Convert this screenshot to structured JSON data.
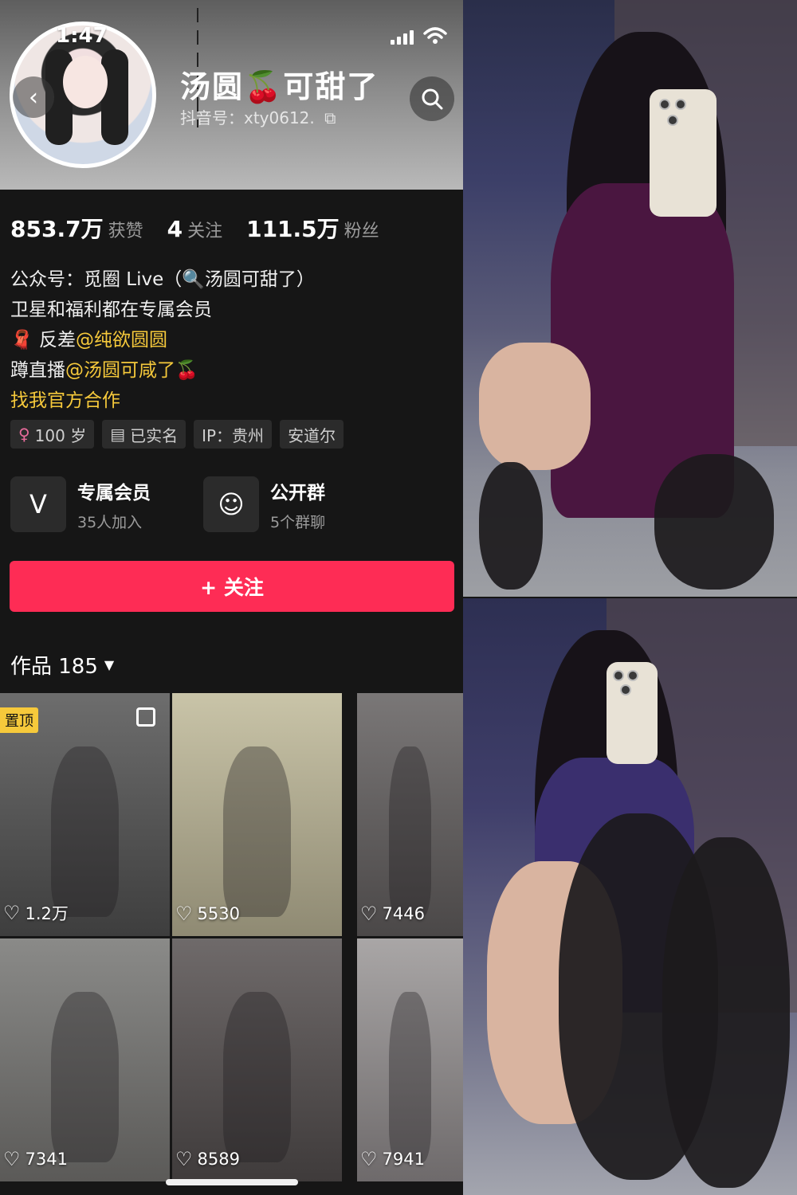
{
  "status_bar": {
    "time": "1:47"
  },
  "profile": {
    "name": "汤圆🍒可甜了",
    "douyin_id": "抖音号：xty0612.",
    "stats": [
      {
        "value": "853.7万",
        "label": "获赞"
      },
      {
        "value": "4",
        "label": "关注"
      },
      {
        "value": "111.5万",
        "label": "粉丝"
      }
    ],
    "bio": {
      "line1": "公众号：觅圈 Live（🔍汤圆可甜了）",
      "line2": "卫星和福利都在专属会员",
      "line3_prefix": "🧣 反差",
      "line3_link": "@纯欲圆圆",
      "line4_prefix": "蹲直播",
      "line4_link": "@汤圆可咸了",
      "line4_suffix": "🍒",
      "line5": "找我官方合作"
    },
    "tags": [
      {
        "icon": "female-icon",
        "glyph": "♀",
        "text": "100 岁"
      },
      {
        "icon": "id-card-icon",
        "glyph": "▤",
        "text": "已实名"
      },
      {
        "icon": "",
        "glyph": "",
        "text": "IP：贵州"
      },
      {
        "icon": "",
        "glyph": "",
        "text": "安道尔"
      }
    ],
    "cards": [
      {
        "icon": "vip-icon",
        "glyph": "V",
        "title": "专属会员",
        "sub": "35人加入"
      },
      {
        "icon": "group-chat-icon",
        "glyph": "☺",
        "title": "公开群",
        "sub": "5个群聊"
      }
    ],
    "follow_label": "+ 关注",
    "works_label": "作品 185"
  },
  "works": [
    {
      "likes": "1.2万",
      "pinned_label": "置顶",
      "multi": true,
      "colors": [
        "#6d6d6d",
        "#3e3e3e"
      ]
    },
    {
      "likes": "5530",
      "colors": [
        "#c9c4a8",
        "#8f8a73"
      ]
    },
    {
      "likes": "7446",
      "colors": [
        "#7a7777",
        "#4b4848"
      ]
    },
    {
      "likes": "7341",
      "colors": [
        "#8a8a88",
        "#5b5a58"
      ]
    },
    {
      "likes": "8589",
      "colors": [
        "#6f6a6a",
        "#3f3b3b"
      ]
    },
    {
      "likes": "7941",
      "colors": [
        "#a9a6a6",
        "#6e6a6b"
      ]
    }
  ]
}
